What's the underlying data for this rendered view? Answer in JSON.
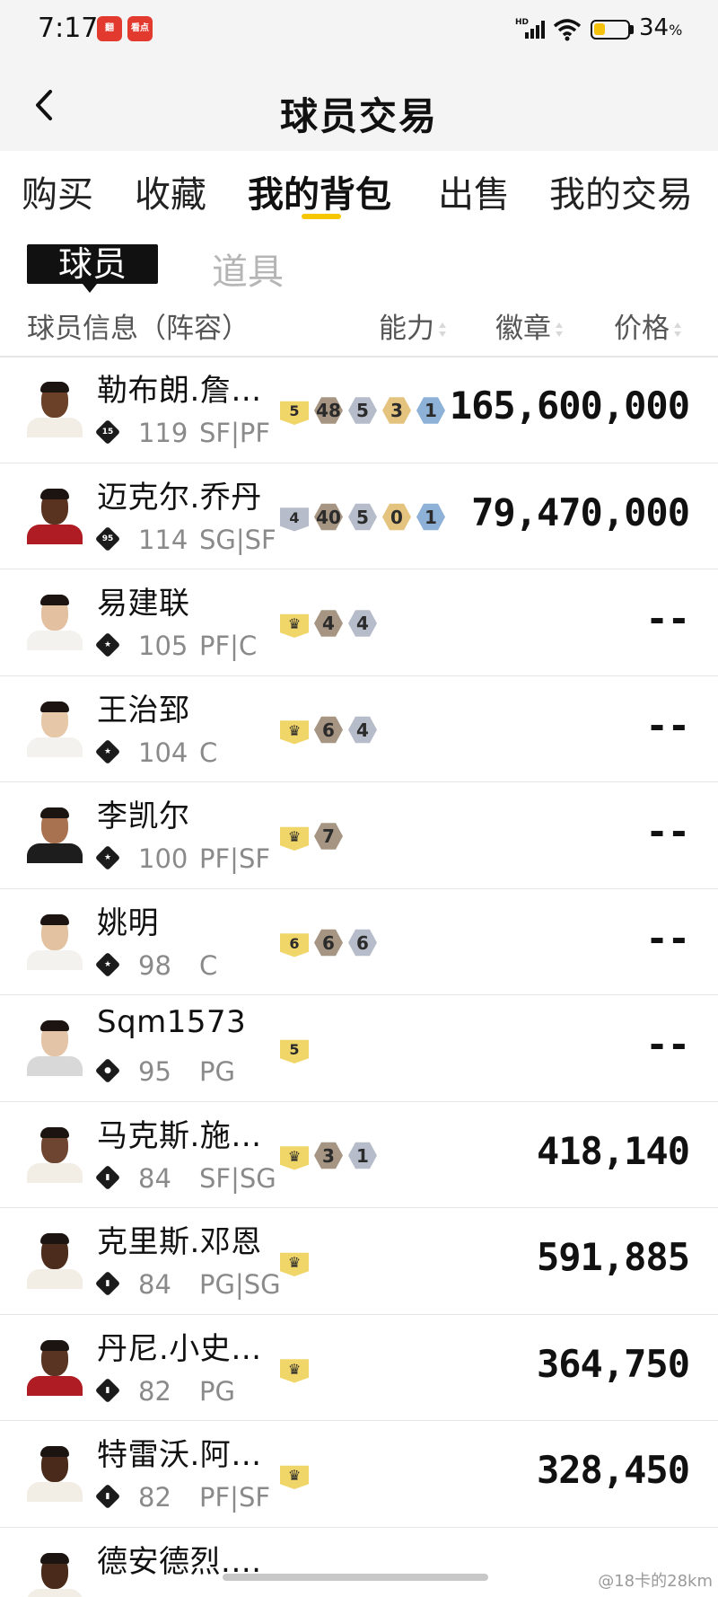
{
  "status_bar": {
    "time": "7:17",
    "app_icons": [
      "翻",
      "看点"
    ],
    "network": "HD",
    "battery_percent": "34",
    "battery_unit": "%",
    "battery_level": 0.34
  },
  "nav": {
    "title": "球员交易",
    "back_icon": "chevron-left-icon"
  },
  "tabs": [
    {
      "label": "购买",
      "active": false
    },
    {
      "label": "收藏",
      "active": false
    },
    {
      "label": "我的背包",
      "active": true
    },
    {
      "label": "出售",
      "active": false
    },
    {
      "label": "我的交易",
      "active": false
    }
  ],
  "subtabs": [
    {
      "label": "球员",
      "active": true
    },
    {
      "label": "道具",
      "active": false
    }
  ],
  "columns": {
    "info": "球员信息（阵容）",
    "ability": "能力",
    "badge": "徽章",
    "price": "价格"
  },
  "colors": {
    "accent": "#f6c600",
    "badge_gold": "#f0d568",
    "badge_bronze": "#a69582",
    "badge_silver": "#b6bcc9",
    "badge_orange": "#e3c37e",
    "badge_blue": "#8eb1d8"
  },
  "players": [
    {
      "name": "勒布朗.詹…",
      "tier": "15",
      "ovr": "119",
      "pos": "SF|PF",
      "price": "165,600,000",
      "skin": "#6b4128",
      "jersey": "#f2eee6",
      "badges": [
        {
          "t": "5",
          "c": "gold",
          "first": true
        },
        {
          "t": "48",
          "c": "bronze"
        },
        {
          "t": "5",
          "c": "silver"
        },
        {
          "t": "3",
          "c": "orange"
        },
        {
          "t": "1",
          "c": "blue"
        }
      ]
    },
    {
      "name": "迈克尔.乔丹",
      "tier": "95",
      "ovr": "114",
      "pos": "SG|SF",
      "price": "79,470,000",
      "skin": "#5a3220",
      "jersey": "#b01c24",
      "badges": [
        {
          "t": "4",
          "c": "silver",
          "first": true
        },
        {
          "t": "40",
          "c": "bronze"
        },
        {
          "t": "5",
          "c": "silver"
        },
        {
          "t": "0",
          "c": "orange"
        },
        {
          "t": "1",
          "c": "blue"
        }
      ]
    },
    {
      "name": "易建联",
      "tier": "★",
      "ovr": "105",
      "pos": "PF|C",
      "price": "--",
      "skin": "#e3c0a0",
      "jersey": "#f4f2ee",
      "badges": [
        {
          "t": "♛",
          "c": "gold",
          "first": true
        },
        {
          "t": "4",
          "c": "bronze"
        },
        {
          "t": "4",
          "c": "silver"
        }
      ]
    },
    {
      "name": "王治郅",
      "tier": "★",
      "ovr": "104",
      "pos": "C",
      "price": "--",
      "skin": "#e6c7a8",
      "jersey": "#f4f2ee",
      "badges": [
        {
          "t": "♛",
          "c": "gold",
          "first": true
        },
        {
          "t": "6",
          "c": "bronze"
        },
        {
          "t": "4",
          "c": "silver"
        }
      ]
    },
    {
      "name": "李凯尔",
      "tier": "★",
      "ovr": "100",
      "pos": "PF|SF",
      "price": "--",
      "skin": "#a87250",
      "jersey": "#1d1d1d",
      "badges": [
        {
          "t": "♛",
          "c": "gold",
          "first": true
        },
        {
          "t": "7",
          "c": "bronze"
        }
      ]
    },
    {
      "name": "姚明",
      "tier": "★",
      "ovr": "98",
      "pos": "C",
      "price": "--",
      "skin": "#e3c2a2",
      "jersey": "#f4f2ee",
      "badges": [
        {
          "t": "6",
          "c": "gold",
          "first": true
        },
        {
          "t": "6",
          "c": "bronze"
        },
        {
          "t": "6",
          "c": "silver"
        }
      ]
    },
    {
      "name": "Sqm1573",
      "tier": "●",
      "ovr": "95",
      "pos": "PG",
      "price": "--",
      "skin": "#e4c4a6",
      "jersey": "#d8d8d8",
      "badges": [
        {
          "t": "5",
          "c": "gold",
          "first": true
        }
      ]
    },
    {
      "name": "马克斯.施…",
      "tier": "▮",
      "ovr": "84",
      "pos": "SF|SG",
      "price": "418,140",
      "skin": "#6e4530",
      "jersey": "#f2eee6",
      "badges": [
        {
          "t": "♛",
          "c": "gold",
          "first": true
        },
        {
          "t": "3",
          "c": "bronze"
        },
        {
          "t": "1",
          "c": "silver"
        }
      ]
    },
    {
      "name": "克里斯.邓恩",
      "tier": "▮",
      "ovr": "84",
      "pos": "PG|SG",
      "price": "591,885",
      "skin": "#4c2c1c",
      "jersey": "#f2eee6",
      "badges": [
        {
          "t": "♛",
          "c": "gold",
          "first": true
        }
      ]
    },
    {
      "name": "丹尼.小史…",
      "tier": "▮",
      "ovr": "82",
      "pos": "PG",
      "price": "364,750",
      "skin": "#5a3422",
      "jersey": "#b01c24",
      "badges": [
        {
          "t": "♛",
          "c": "gold",
          "first": true
        }
      ]
    },
    {
      "name": "特雷沃.阿…",
      "tier": "▮",
      "ovr": "82",
      "pos": "PF|SF",
      "price": "328,450",
      "skin": "#4a2a1a",
      "jersey": "#f2eee6",
      "badges": [
        {
          "t": "♛",
          "c": "gold",
          "first": true
        }
      ]
    },
    {
      "name": "德安德烈.…",
      "tier": "",
      "ovr": "",
      "pos": "",
      "price": "",
      "skin": "#4a2a1a",
      "jersey": "#f2eee6",
      "badges": []
    }
  ],
  "watermark": "@18卡的28km"
}
